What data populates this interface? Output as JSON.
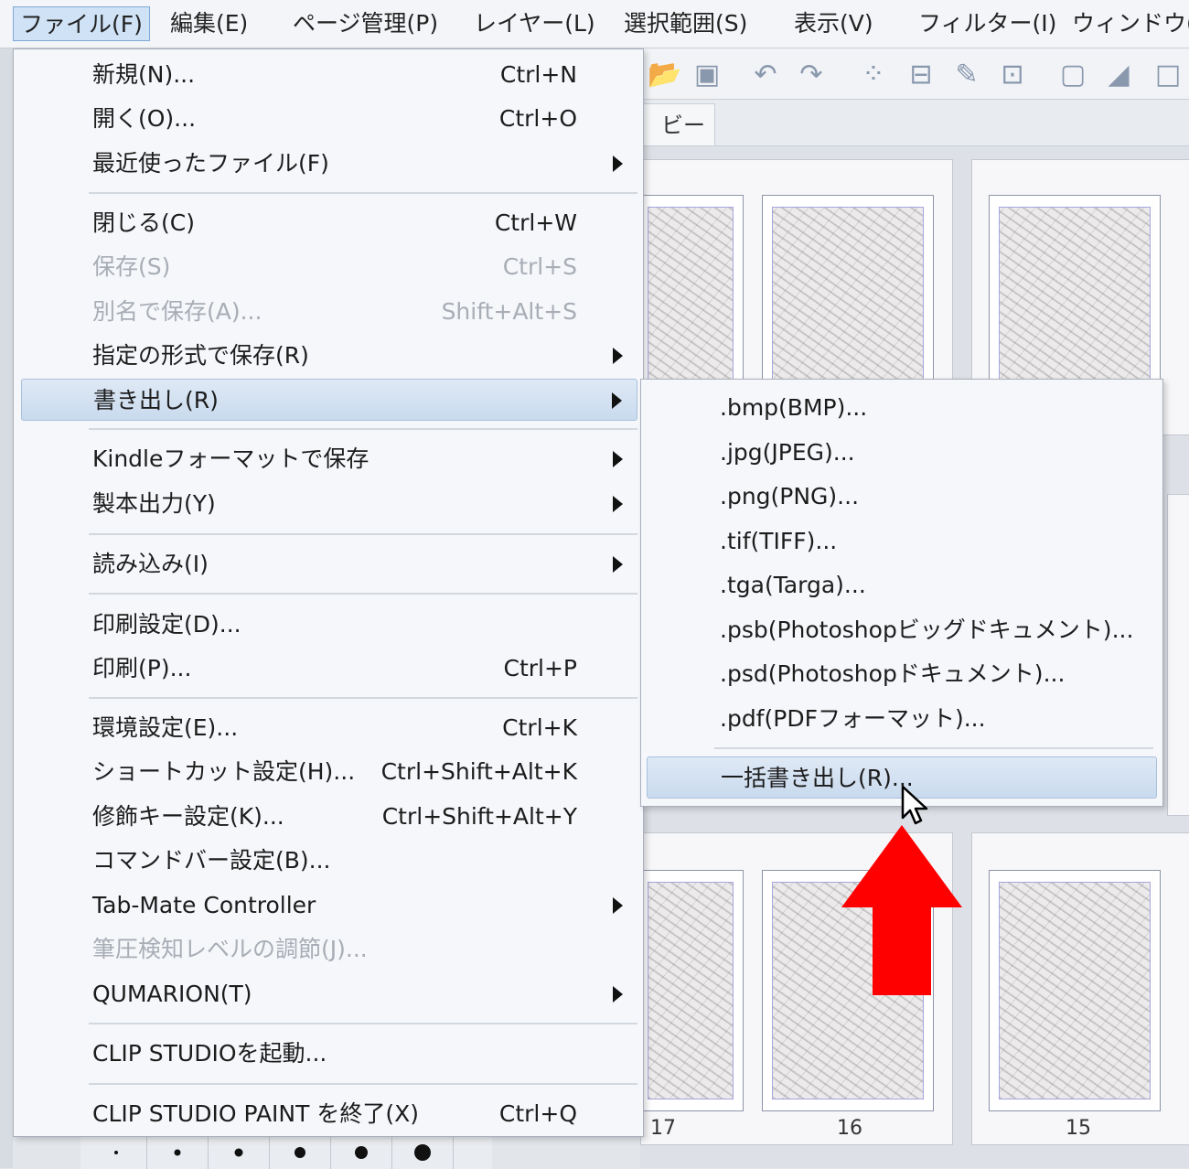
{
  "menubar": {
    "items": [
      {
        "label": "ファイル(F)"
      },
      {
        "label": "編集(E)"
      },
      {
        "label": "ページ管理(P)"
      },
      {
        "label": "レイヤー(L)"
      },
      {
        "label": "選択範囲(S)"
      },
      {
        "label": "表示(V)"
      },
      {
        "label": "フィルター(I)"
      },
      {
        "label": "ウィンドウ(W"
      }
    ]
  },
  "tab": {
    "label": "ビー ×"
  },
  "file_menu": {
    "items": [
      {
        "label": "新規(N)...",
        "shortcut": "Ctrl+N"
      },
      {
        "label": "開く(O)...",
        "shortcut": "Ctrl+O"
      },
      {
        "label": "最近使ったファイル(F)",
        "shortcut": ""
      },
      {
        "label": "閉じる(C)",
        "shortcut": "Ctrl+W"
      },
      {
        "label": "保存(S)",
        "shortcut": "Ctrl+S"
      },
      {
        "label": "別名で保存(A)...",
        "shortcut": "Shift+Alt+S"
      },
      {
        "label": "指定の形式で保存(R)",
        "shortcut": ""
      },
      {
        "label": "書き出し(R)",
        "shortcut": ""
      },
      {
        "label": "Kindleフォーマットで保存",
        "shortcut": ""
      },
      {
        "label": "製本出力(Y)",
        "shortcut": ""
      },
      {
        "label": "読み込み(I)",
        "shortcut": ""
      },
      {
        "label": "印刷設定(D)...",
        "shortcut": ""
      },
      {
        "label": "印刷(P)...",
        "shortcut": "Ctrl+P"
      },
      {
        "label": "環境設定(E)...",
        "shortcut": "Ctrl+K"
      },
      {
        "label": "ショートカット設定(H)...",
        "shortcut": "Ctrl+Shift+Alt+K"
      },
      {
        "label": "修飾キー設定(K)...",
        "shortcut": "Ctrl+Shift+Alt+Y"
      },
      {
        "label": "コマンドバー設定(B)...",
        "shortcut": ""
      },
      {
        "label": "Tab-Mate Controller",
        "shortcut": ""
      },
      {
        "label": "筆圧検知レベルの調節(J)...",
        "shortcut": ""
      },
      {
        "label": "QUMARION(T)",
        "shortcut": ""
      },
      {
        "label": "CLIP STUDIOを起動...",
        "shortcut": ""
      },
      {
        "label": "CLIP STUDIO PAINT を終了(X)",
        "shortcut": "Ctrl+Q"
      }
    ]
  },
  "export_submenu": {
    "items": [
      {
        "label": ".bmp(BMP)..."
      },
      {
        "label": ".jpg(JPEG)..."
      },
      {
        "label": ".png(PNG)..."
      },
      {
        "label": ".tif(TIFF)..."
      },
      {
        "label": ".tga(Targa)..."
      },
      {
        "label": ".psb(Photoshopビッグドキュメント)..."
      },
      {
        "label": ".psd(Photoshopドキュメント)..."
      },
      {
        "label": ".pdf(PDFフォーマット)..."
      },
      {
        "label": "一括書き出し(R)..."
      }
    ]
  },
  "pages": [
    {
      "number": "17"
    },
    {
      "number": "16"
    },
    {
      "number": "15"
    }
  ],
  "colors": {
    "highlight": "#c9daee",
    "arrow": "#ff0000",
    "menu_bg": "#f5f7fa"
  },
  "icons": [
    "submenu-arrow-icon",
    "mouse-cursor-icon",
    "red-up-arrow-icon",
    "close-icon"
  ]
}
